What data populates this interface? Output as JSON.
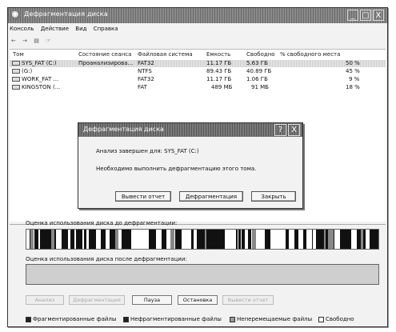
{
  "window": {
    "title": "Дефрагментация диска",
    "controls": {
      "minimize": "_",
      "maximize": "□",
      "close": "X"
    }
  },
  "menu": [
    "Консоль",
    "Действие",
    "Вид",
    "Справка"
  ],
  "toolbar": [
    "←",
    "→",
    "▤",
    "☞"
  ],
  "columns": [
    "Том",
    "Состояние сеанса",
    "Файловая система",
    "Емкость",
    "Свободно",
    "% свободного места"
  ],
  "volumes": [
    {
      "name": "SYS_FAT (C:)",
      "status": "Проанализирова...",
      "fs": "FAT32",
      "capacity": "11.17 ГБ",
      "free": "5.63 ГБ",
      "percent": "50 %"
    },
    {
      "name": "(G:)",
      "status": "",
      "fs": "NTFS",
      "capacity": "89.43 ГБ",
      "free": "40.89 ГБ",
      "percent": "45 %"
    },
    {
      "name": "WORK_FAT ...",
      "status": "",
      "fs": "FAT32",
      "capacity": "11.17 ГБ",
      "free": "1.06 ГБ",
      "percent": "9 %"
    },
    {
      "name": "KINGSTON (...",
      "status": "",
      "fs": "FAT",
      "capacity": "489 МБ",
      "free": "91 МБ",
      "percent": "18 %"
    }
  ],
  "dialog": {
    "title": "Дефрагментация диска",
    "line1": "Анализ завершен для: SYS_FAT (C:)",
    "line2": "Необходимо выполнить дефрагментацию этого тома.",
    "buttons": {
      "report": "Вывести отчет",
      "defrag": "Дефрагментация",
      "close": "Закрыть"
    },
    "controls": {
      "help": "?",
      "close": "X"
    }
  },
  "before_label": "Оценка использования диска до дефрагментации:",
  "after_label": "Оценка использования диска после дефрагментации:",
  "actions": {
    "analyze": "Анализ",
    "defrag": "Дефрагментация",
    "pause": "Пауза",
    "stop": "Остановка",
    "report": "Вывести отчет"
  },
  "legend": {
    "fragmented": "Фрагментированные файлы",
    "unfragmented": "Нефрагментированные файлы",
    "unmovable": "Неперемещаемые файлы",
    "free": "Свободно"
  }
}
